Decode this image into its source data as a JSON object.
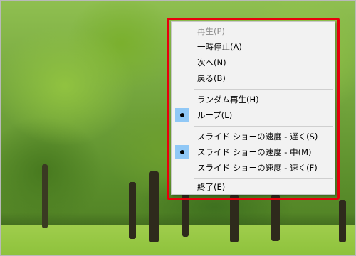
{
  "menu": {
    "items": [
      {
        "label": "再生(P)",
        "enabled": false,
        "checked": false
      },
      {
        "label": "一時停止(A)",
        "enabled": true,
        "checked": false
      },
      {
        "label": "次へ(N)",
        "enabled": true,
        "checked": false
      },
      {
        "label": "戻る(B)",
        "enabled": true,
        "checked": false
      },
      {
        "label": "ランダム再生(H)",
        "enabled": true,
        "checked": false
      },
      {
        "label": "ループ(L)",
        "enabled": true,
        "checked": true
      },
      {
        "label": "スライド ショーの速度 - 遅く(S)",
        "enabled": true,
        "checked": false
      },
      {
        "label": "スライド ショーの速度 - 中(M)",
        "enabled": true,
        "checked": true
      },
      {
        "label": "スライド ショーの速度 - 速く(F)",
        "enabled": true,
        "checked": false
      },
      {
        "label": "終了(E)",
        "enabled": true,
        "checked": false
      }
    ]
  },
  "colors": {
    "highlight_border": "#e8000c",
    "check_background": "#90c8f6",
    "menu_background": "#f2f2f2"
  }
}
